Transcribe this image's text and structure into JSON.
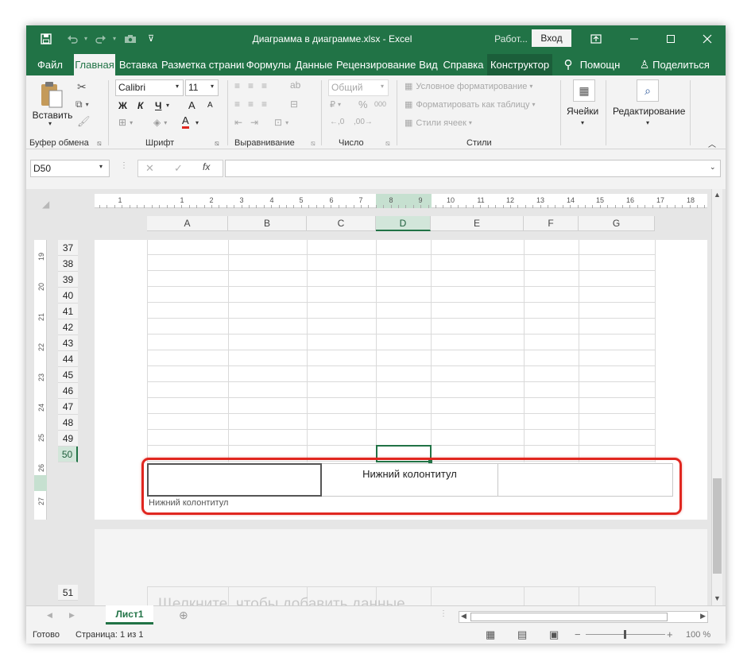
{
  "titlebar": {
    "title": "Диаграмма в диаграмме.xlsx  -  Excel",
    "context_label": "Работ...",
    "login_label": "Вход"
  },
  "tabs": [
    "Файл",
    "Главная",
    "Вставка",
    "Разметка страниц",
    "Формулы",
    "Данные",
    "Рецензирование",
    "Вид",
    "Справка",
    "Конструктор"
  ],
  "tellme": "Помощн",
  "share": "Поделиться",
  "ribbon": {
    "clipboard": {
      "paste_label": "Вставить",
      "group_label": "Буфер обмена"
    },
    "font": {
      "name": "Calibri",
      "size": "11",
      "group_label": "Шрифт",
      "bold": "Ж",
      "italic": "К",
      "underline": "Ч",
      "grow": "A",
      "shrink": "A",
      "fontcolor": "A"
    },
    "alignment": {
      "group_label": "Выравнивание"
    },
    "number": {
      "format": "Общий",
      "group_label": "Число",
      "percent": "%",
      "thousands": "000"
    },
    "styles": {
      "conditional": "Условное форматирование",
      "as_table": "Форматировать как таблицу",
      "cell_styles": "Стили ячеек",
      "group_label": "Стили"
    },
    "cells": {
      "label": "Ячейки"
    },
    "editing": {
      "label": "Редактирование"
    }
  },
  "formula_bar": {
    "name_box": "D50",
    "fx": "fx",
    "value": ""
  },
  "ruler_h": [
    "1",
    "1",
    "2",
    "3",
    "4",
    "5",
    "6",
    "7",
    "8",
    "9",
    "10",
    "11",
    "12",
    "13",
    "14",
    "15",
    "16",
    "17",
    "18"
  ],
  "ruler_v": [
    "19",
    "20",
    "21",
    "22",
    "23",
    "24",
    "25",
    "26",
    "27"
  ],
  "columns": [
    "A",
    "B",
    "C",
    "D",
    "E",
    "F",
    "G"
  ],
  "rows": [
    "37",
    "38",
    "39",
    "40",
    "41",
    "42",
    "43",
    "44",
    "45",
    "46",
    "47",
    "48",
    "49",
    "50"
  ],
  "next_page_row": "51",
  "footer": {
    "center_text": "Нижний колонтитул",
    "label": "Нижний колонтитул"
  },
  "next_page_hint": "Щелкните, чтобы добавить данные",
  "sheet_tab": "Лист1",
  "status": {
    "ready": "Готово",
    "page": "Страница: 1 из 1",
    "zoom": "100 %",
    "minus": "−",
    "plus": "+"
  },
  "colors": {
    "accent": "#217346",
    "highlight": "#e0261f"
  }
}
